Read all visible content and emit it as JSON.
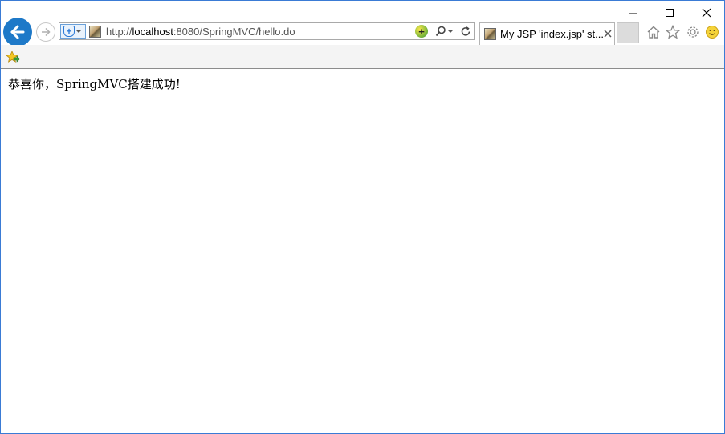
{
  "browser": {
    "address_bar": {
      "url_prefix": "http://",
      "url_host": "localhost",
      "url_rest": ":8080/SpringMVC/hello.do"
    },
    "tab": {
      "title": "My JSP 'index.jsp' st..."
    },
    "icons": {
      "back": "back-arrow-icon",
      "forward": "forward-arrow-icon",
      "home": "home-icon",
      "favorites": "star-icon",
      "settings": "gear-icon",
      "feedback": "smiley-icon"
    },
    "accent_color": "#1e79c8"
  },
  "page": {
    "message": "恭喜你，SpringMVC搭建成功!"
  }
}
